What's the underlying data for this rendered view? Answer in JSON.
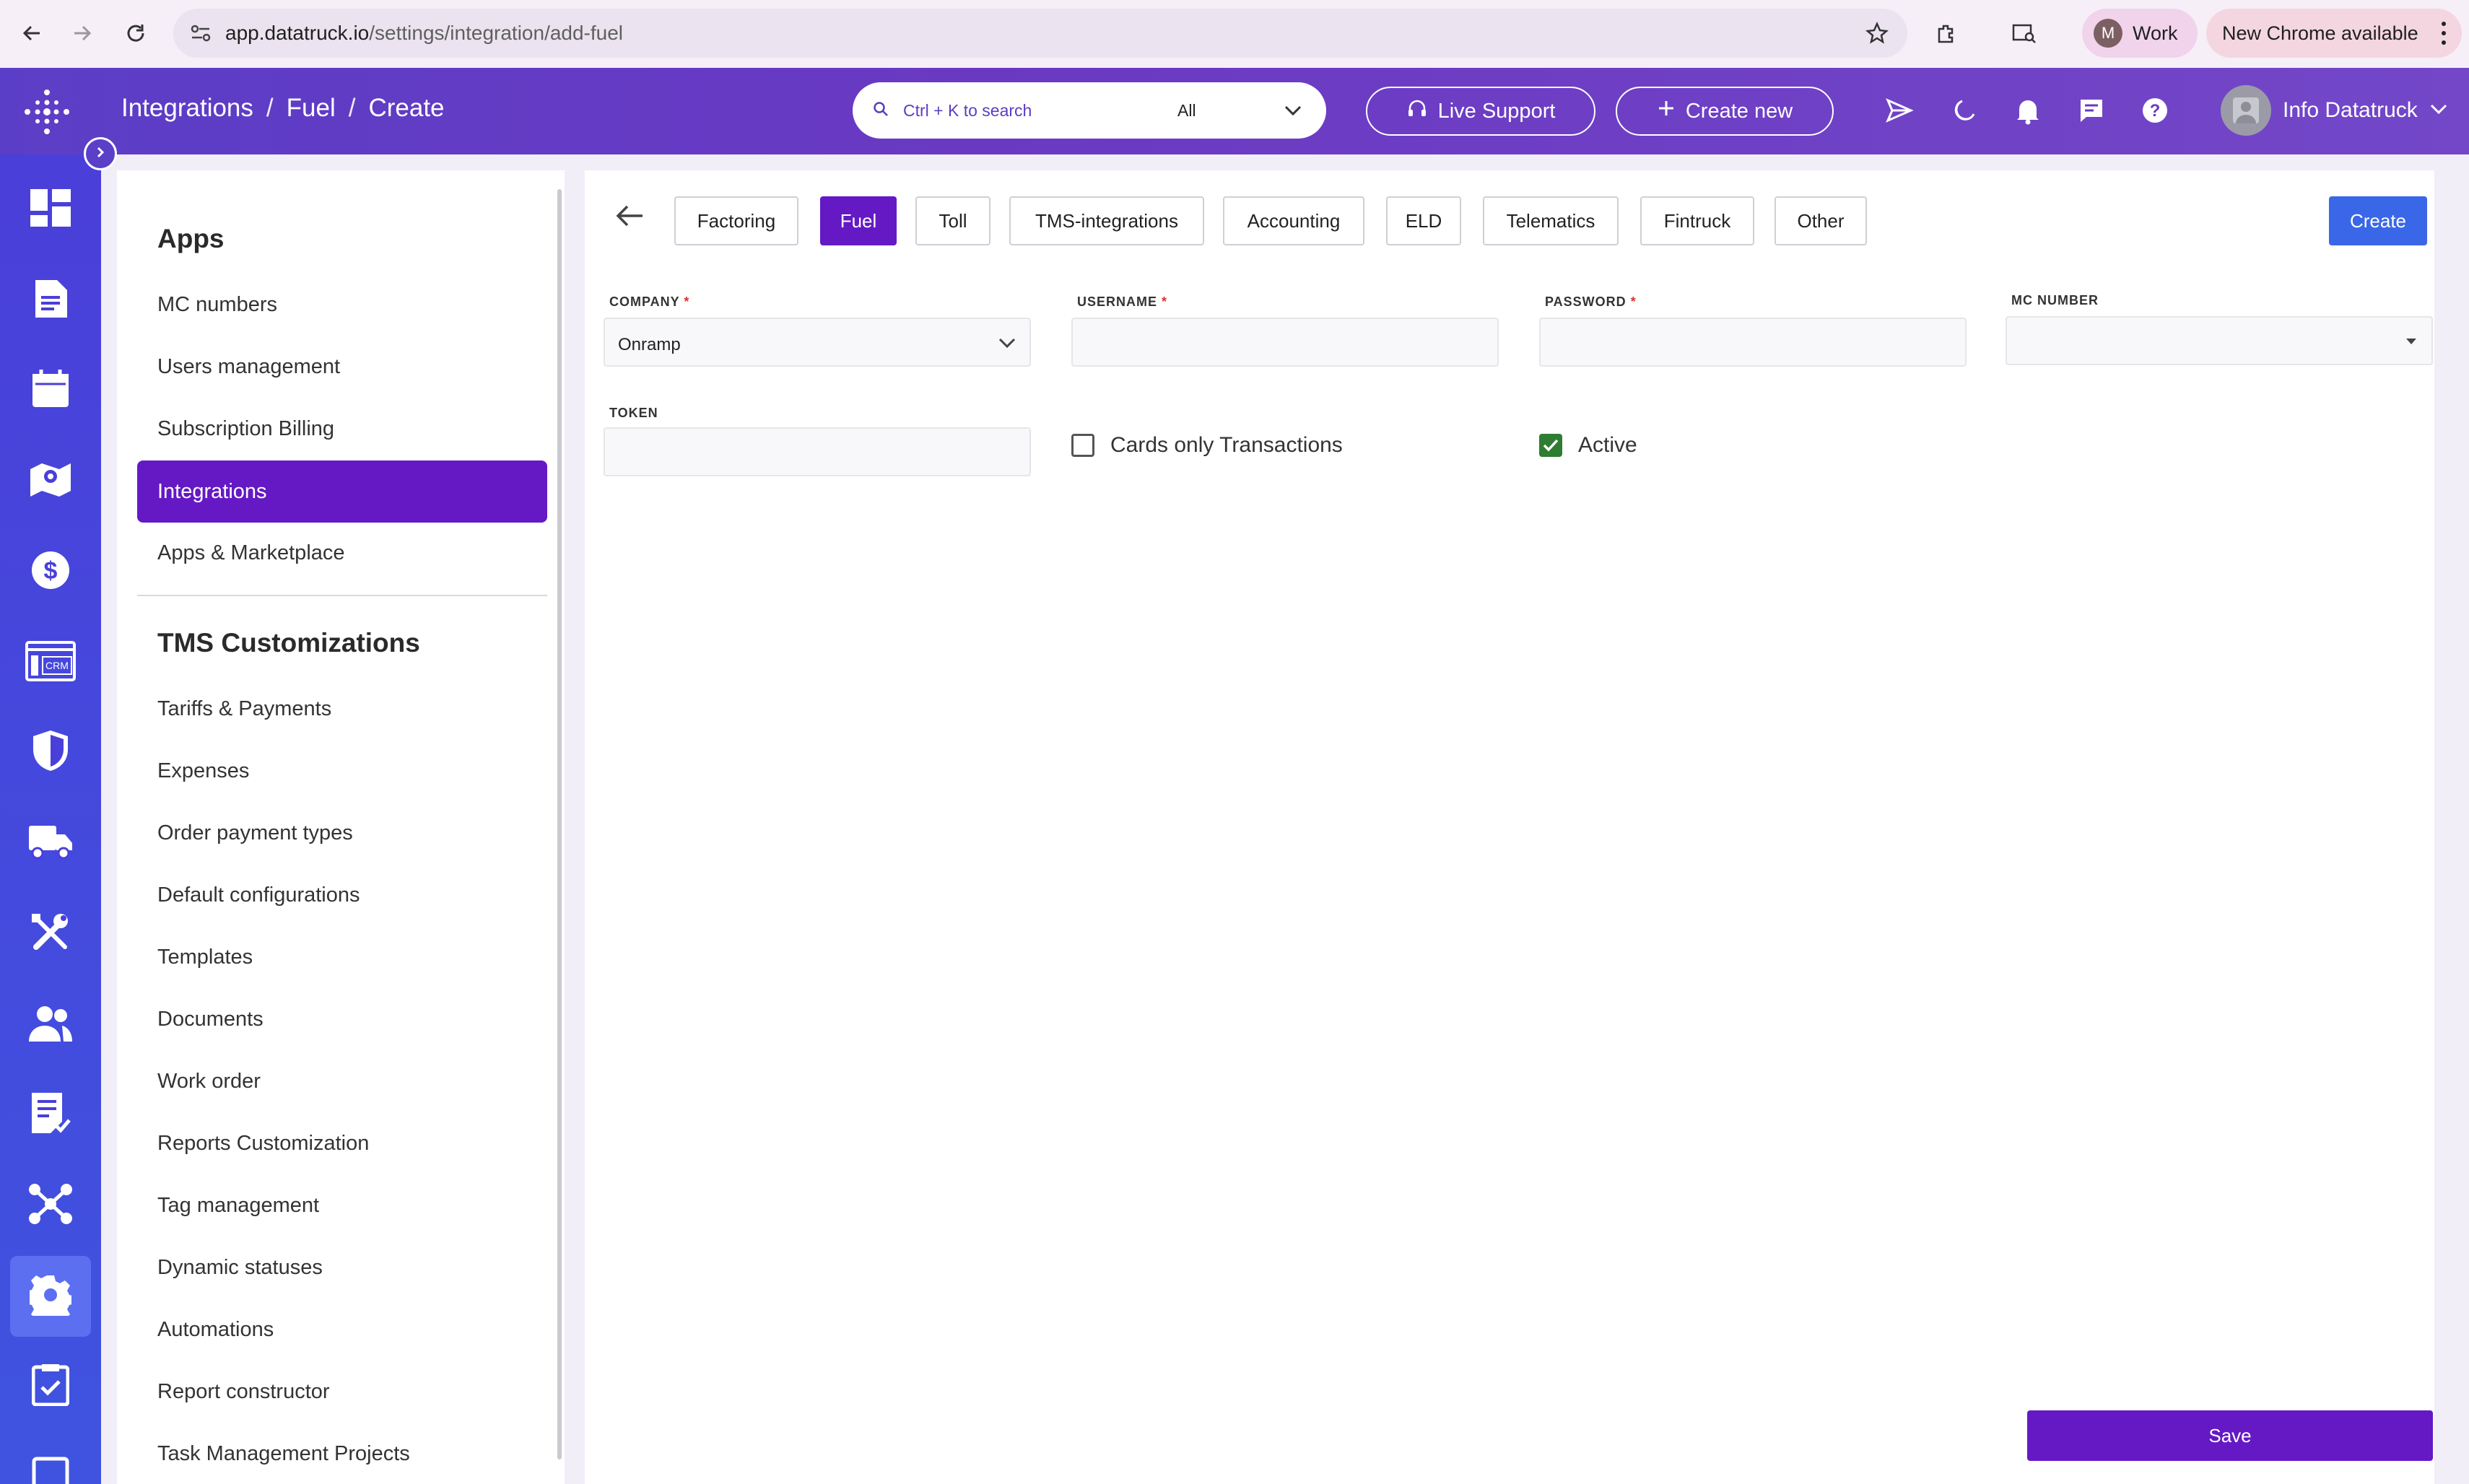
{
  "browser": {
    "url_host": "app.datatruck.io",
    "url_path": "/settings/integration/add-fuel",
    "profile_initial": "M",
    "profile_label": "Work",
    "update_label": "New Chrome available"
  },
  "topbar": {
    "breadcrumb": [
      "Integrations",
      "Fuel",
      "Create"
    ],
    "search_placeholder": "Ctrl + K to search",
    "search_scope": "All",
    "live_support": "Live Support",
    "create_new": "Create new",
    "user_name": "Info Datatruck"
  },
  "rail": {
    "icons": [
      "dashboard-icon",
      "document-icon",
      "calendar-icon",
      "map-icon",
      "dollar-icon",
      "crm-icon",
      "shield-icon",
      "truck-icon",
      "tools-icon",
      "users-icon",
      "report-icon",
      "network-icon",
      "gear-icon",
      "checklist-icon",
      "square-icon"
    ],
    "crm_text": "CRM",
    "active": "gear-icon"
  },
  "menu": {
    "apps_heading": "Apps",
    "apps_items": [
      "MC numbers",
      "Users management",
      "Subscription Billing",
      "Integrations",
      "Apps & Marketplace"
    ],
    "active_item": "Integrations",
    "tms_heading": "TMS Customizations",
    "tms_items": [
      "Tariffs & Payments",
      "Expenses",
      "Order payment types",
      "Default configurations",
      "Templates",
      "Documents",
      "Work order",
      "Reports Customization",
      "Tag management",
      "Dynamic statuses",
      "Automations",
      "Report constructor",
      "Task Management Projects"
    ]
  },
  "main": {
    "tabs": [
      "Factoring",
      "Fuel",
      "Toll",
      "TMS-integrations",
      "Accounting",
      "ELD",
      "Telematics",
      "Fintruck",
      "Other"
    ],
    "active_tab": "Fuel",
    "create_button": "Create",
    "fields": {
      "company": {
        "label": "COMPANY",
        "required": "*",
        "value": "Onramp"
      },
      "username": {
        "label": "USERNAME",
        "required": "*",
        "value": ""
      },
      "password": {
        "label": "PASSWORD",
        "required": "*",
        "value": ""
      },
      "mc_number": {
        "label": "MC NUMBER",
        "value": ""
      },
      "token": {
        "label": "TOKEN",
        "value": ""
      }
    },
    "cards_only": {
      "label": "Cards only Transactions",
      "checked": false
    },
    "active": {
      "label": "Active",
      "checked": true
    },
    "save_button": "Save"
  },
  "colors": {
    "brand_purple": "#6419c5",
    "rail_blue": "#4a3fd9",
    "create_blue": "#3a67e8",
    "check_green": "#2e7d32"
  }
}
